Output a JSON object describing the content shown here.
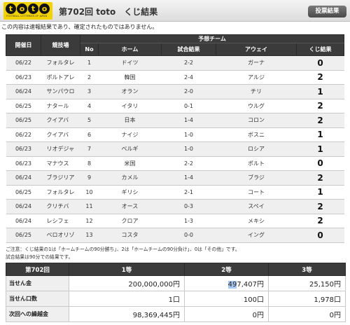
{
  "header": {
    "logo_letters": [
      "t",
      "o",
      "t",
      "o"
    ],
    "logo_subtitle": "FOOTBALL LOTTERIES OF JAPAN",
    "title": "第702回 toto　くじ結果",
    "vote_button": "投票結果"
  },
  "notice": "この内容は速報結果であり、確定されたものではありません。",
  "matches_table": {
    "group_header": "予想チーム",
    "columns": [
      "開催日",
      "競技場",
      "No",
      "ホーム",
      "試合結果",
      "アウェイ",
      "くじ結果"
    ],
    "rows": [
      {
        "date": "06/22",
        "stadium": "フォルタレ",
        "no": "1",
        "home": "ドイツ",
        "score": "2-2",
        "away": "ガーナ",
        "result": "0"
      },
      {
        "date": "06/23",
        "stadium": "ポルトアレ",
        "no": "2",
        "home": "韓国",
        "score": "2-4",
        "away": "アルジ",
        "result": "2"
      },
      {
        "date": "06/24",
        "stadium": "サンパウロ",
        "no": "3",
        "home": "オラン",
        "score": "2-0",
        "away": "チリ",
        "result": "1"
      },
      {
        "date": "06/25",
        "stadium": "ナタール",
        "no": "4",
        "home": "イタリ",
        "score": "0-1",
        "away": "ウルグ",
        "result": "2"
      },
      {
        "date": "06/25",
        "stadium": "クイアバ",
        "no": "5",
        "home": "日本",
        "score": "1-4",
        "away": "コロン",
        "result": "2"
      },
      {
        "date": "06/22",
        "stadium": "クイアバ",
        "no": "6",
        "home": "ナイジ",
        "score": "1-0",
        "away": "ボスニ",
        "result": "1"
      },
      {
        "date": "06/23",
        "stadium": "リオデジャ",
        "no": "7",
        "home": "ベルギ",
        "score": "1-0",
        "away": "ロシア",
        "result": "1"
      },
      {
        "date": "06/23",
        "stadium": "マナウス",
        "no": "8",
        "home": "米国",
        "score": "2-2",
        "away": "ポルト",
        "result": "0"
      },
      {
        "date": "06/24",
        "stadium": "ブラジリア",
        "no": "9",
        "home": "カメル",
        "score": "1-4",
        "away": "ブラジ",
        "result": "2"
      },
      {
        "date": "06/25",
        "stadium": "フォルタレ",
        "no": "10",
        "home": "ギリシ",
        "score": "2-1",
        "away": "コート",
        "result": "1"
      },
      {
        "date": "06/24",
        "stadium": "クリチバ",
        "no": "11",
        "home": "オース",
        "score": "0-3",
        "away": "スペイ",
        "result": "2"
      },
      {
        "date": "06/24",
        "stadium": "レシフェ",
        "no": "12",
        "home": "クロア",
        "score": "1-3",
        "away": "メキシ",
        "result": "2"
      },
      {
        "date": "06/25",
        "stadium": "ベロオリゾ",
        "no": "13",
        "home": "コスタ",
        "score": "0-0",
        "away": "イング",
        "result": "0"
      }
    ]
  },
  "note_1": "ご注意：くじ結果の1は「ホームチームの90分勝ち」、2は「ホームチームの90分負け」、0は「その他」です。",
  "note_2": "試合結果は90分での結果です。",
  "payout_table": {
    "columns": [
      "第702回",
      "1等",
      "2等",
      "3等"
    ],
    "rows": [
      {
        "label": "当せん金",
        "values": [
          "200,000,000円",
          "497,407円",
          "25,150円"
        ]
      },
      {
        "label": "当せん口数",
        "values": [
          "1口",
          "100口",
          "1,978口"
        ]
      },
      {
        "label": "次回への繰越金",
        "values": [
          "98,369,445円",
          "0円",
          "0円"
        ]
      }
    ],
    "highlighted_digits": "49"
  }
}
